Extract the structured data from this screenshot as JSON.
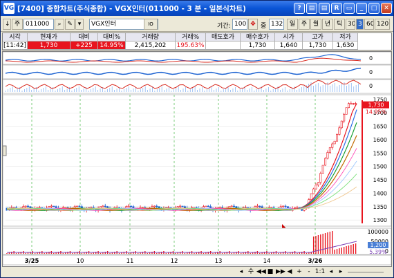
{
  "window": {
    "app_icon": "VG",
    "title": "[7400] 종합차트(주식종합) - VGX인터(011000 - 3 분 - 일본식차트)",
    "buttons": [
      "?",
      "▤",
      "▤",
      "R",
      "▭",
      "_",
      "□",
      "✕"
    ]
  },
  "toolbar": {
    "arrow": "↓",
    "market": "주",
    "code": "011000",
    "name": "VGX인터",
    "io_label": "IO",
    "period_label": "기간:",
    "period_value": "1001",
    "count_label": "중",
    "count_value": "132",
    "intervals": [
      "일",
      "주",
      "월",
      "년",
      "틱",
      "30",
      "3",
      "60",
      "120"
    ],
    "selected_interval": "3"
  },
  "quote": {
    "headers": [
      "시각",
      "현재가",
      "대비",
      "대비%",
      "거래량",
      "거래%",
      "매도호가",
      "매수호가",
      "시가",
      "고가",
      "저가"
    ],
    "values": [
      "[11:42]",
      "1,730",
      "+225",
      "14.95%",
      "2,415,202",
      "195.63%",
      "",
      "1,730",
      "1,640",
      "1,730",
      "1,630"
    ]
  },
  "chart_data": {
    "type": "candlestick",
    "title": "",
    "x_ticks": [
      "3/25",
      "10",
      "11",
      "12",
      "13",
      "14",
      "3/26"
    ],
    "y_ticks": [
      1750,
      1700,
      1650,
      1600,
      1550,
      1500,
      1450,
      1400,
      1350,
      1300
    ],
    "ylim": [
      1285,
      1760
    ],
    "current_price": "1,730",
    "current_change": "14.95%",
    "volume_ticks": [
      "100000",
      "50000",
      "0"
    ],
    "volume_current": "1,200",
    "volume_pct": "5.39%",
    "ma_series": [
      {
        "color": "#e8141e"
      },
      {
        "color": "#2f6ee8"
      },
      {
        "color": "#1aa033"
      },
      {
        "color": "#c26a00"
      }
    ]
  },
  "bottom": {
    "controls": [
      "◂",
      "수",
      "◀◀",
      "■",
      "▶▶",
      "◀",
      "+",
      "-",
      "1:1",
      "◂",
      "▸"
    ]
  }
}
